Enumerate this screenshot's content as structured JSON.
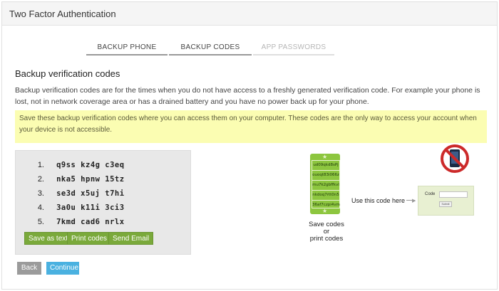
{
  "header": {
    "title": "Two Factor Authentication"
  },
  "tabs": [
    {
      "label": "BACKUP PHONE",
      "state": "active"
    },
    {
      "label": "BACKUP CODES",
      "state": "active"
    },
    {
      "label": "APP PASSWORDS",
      "state": "disabled"
    }
  ],
  "section": {
    "title": "Backup verification codes",
    "description": "Backup verification codes are for the times when you do not have access to a freshly generated verification code. For example your phone is lost, not in network coverage area or has a drained battery and you have no power back up for your phone."
  },
  "notice": {
    "text": "Save these backup verification codes where you can access them on your computer. These codes are the only way to access your account when your device is not accessible.",
    "background": "#fbfdb2"
  },
  "codes": [
    {
      "num": "1.",
      "value": "q9ss kz4g c3eq"
    },
    {
      "num": "2.",
      "value": "nka5 hpnw 15tz"
    },
    {
      "num": "3.",
      "value": "se3d x5uj t7hi"
    },
    {
      "num": "4.",
      "value": "3a0u k11i 3ci3"
    },
    {
      "num": "5.",
      "value": "7kmd cad6 nrlx"
    }
  ],
  "code_actions": {
    "save_as_text": "Save as text",
    "print_codes": "Print codes",
    "send_email": "Send Email"
  },
  "navigation": {
    "back": "Back",
    "continue": "Continue"
  },
  "illustration": {
    "ticket_codes": [
      "ud09qkd8sPj",
      "ouoqt83i066z",
      "mu7k2gbffkvl",
      "nkdoq7rtt0n5",
      "36af7czpi4vm"
    ],
    "caption_line1": "Save codes",
    "caption_line2": "or",
    "caption_line3": "print codes",
    "use_code": "Use this code here",
    "form_label": "Code",
    "form_submit": "Submit",
    "icons": [
      "code-ticket-icon",
      "no-phone-icon",
      "arrow-right-icon"
    ]
  },
  "colors": {
    "accent_green": "#7aa93b",
    "button_blue": "#4ab1e0",
    "button_gray": "#9b9b9b"
  }
}
